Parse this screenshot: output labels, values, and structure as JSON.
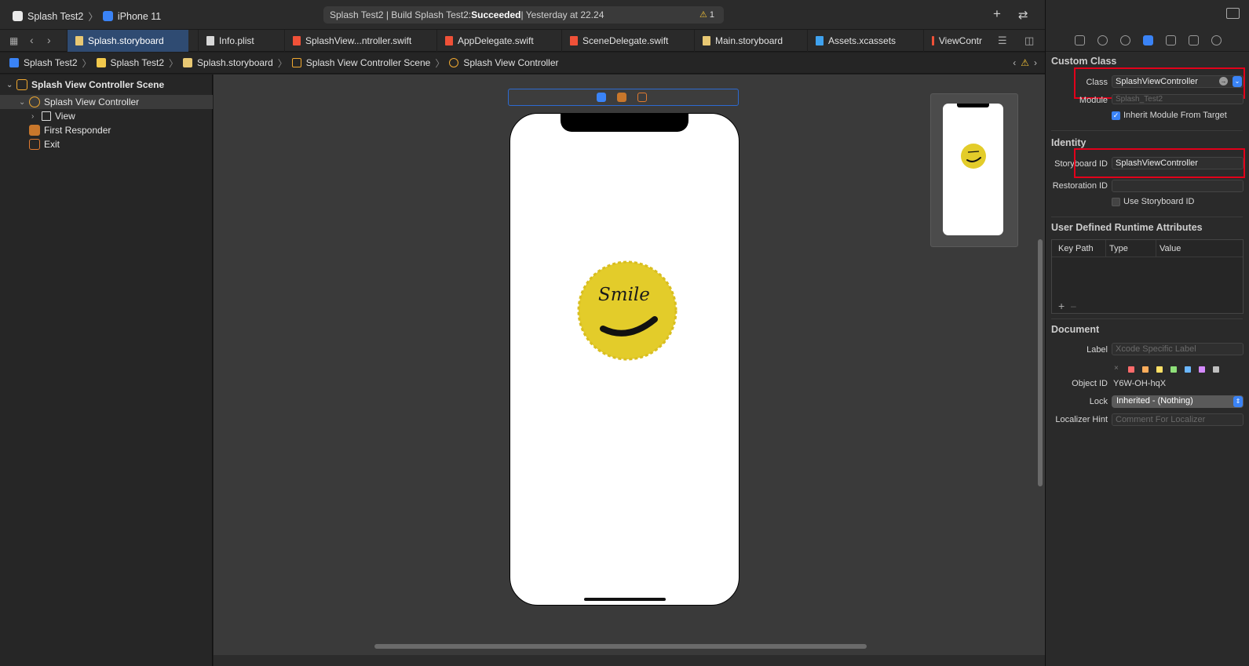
{
  "window": {
    "scheme": "Splash Test2",
    "device": "iPhone 11",
    "status": {
      "prefix": "Splash Test2 | Build Splash Test2: ",
      "result": "Succeeded",
      "suffix": " | Yesterday at 22.24",
      "warning_count": "1"
    }
  },
  "tabs": [
    {
      "label": "Splash.storyboard",
      "type": "sb"
    },
    {
      "label": "Info.plist",
      "type": "file"
    },
    {
      "label": "SplashView...ntroller.swift",
      "type": "swift"
    },
    {
      "label": "AppDelegate.swift",
      "type": "swift"
    },
    {
      "label": "SceneDelegate.swift",
      "type": "swift"
    },
    {
      "label": "Main.storyboard",
      "type": "sb"
    },
    {
      "label": "Assets.xcassets",
      "type": "assets"
    },
    {
      "label": "ViewContr",
      "type": "swift"
    }
  ],
  "breadcrumb": [
    "Splash Test2",
    "Splash Test2",
    "Splash.storyboard",
    "Splash View Controller Scene",
    "Splash View Controller"
  ],
  "outline": {
    "scene": "Splash View Controller Scene",
    "controller": "Splash View Controller",
    "view": "View",
    "first_responder": "First Responder",
    "exit": "Exit"
  },
  "canvas": {
    "image_text": "Smile"
  },
  "inspector": {
    "custom_class": {
      "title": "Custom Class",
      "class_label": "Class",
      "class_value": "SplashViewController",
      "module_label": "Module",
      "module_value": "Splash_Test2",
      "inherit_label": "Inherit Module From Target",
      "inherit_checked": true
    },
    "identity": {
      "title": "Identity",
      "storyboard_id_label": "Storyboard ID",
      "storyboard_id_value": "SplashViewController",
      "restoration_id_label": "Restoration ID",
      "restoration_id_value": "",
      "use_storyboard_id_label": "Use Storyboard ID",
      "use_storyboard_id_checked": false
    },
    "runtime_attributes": {
      "title": "User Defined Runtime Attributes",
      "columns": [
        "Key Path",
        "Type",
        "Value"
      ],
      "add": "+",
      "remove": "–"
    },
    "document": {
      "title": "Document",
      "label_label": "Label",
      "label_placeholder": "Xcode Specific Label",
      "object_id_label": "Object ID",
      "object_id_value": "Y6W-OH-hqX",
      "lock_label": "Lock",
      "lock_value": "Inherited - (Nothing)",
      "localizer_label": "Localizer Hint",
      "localizer_placeholder": "Comment For Localizer",
      "label_colors": [
        "#ff6b6b",
        "#ffad5c",
        "#ffe066",
        "#8fe07a",
        "#6bb7ff",
        "#d58aff",
        "#bfbfbf"
      ]
    }
  }
}
